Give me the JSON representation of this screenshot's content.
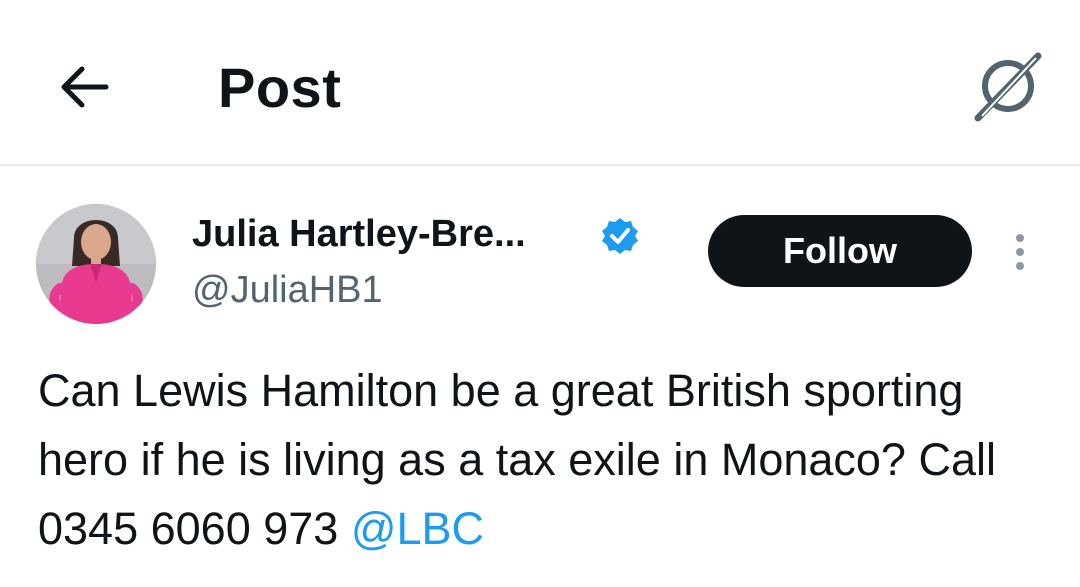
{
  "header": {
    "title": "Post",
    "back_icon": "arrow-left-icon",
    "grok_icon": "grok-icon"
  },
  "post": {
    "author": {
      "name": "Julia Hartley-Bre...",
      "handle": "@JuliaHB1",
      "verified": true,
      "verified_color": "#1d9bf0"
    },
    "follow_label": "Follow",
    "more_icon": "more-vertical-icon",
    "text": "Can Lewis Hamilton be a great British sporting hero if he is living as a tax exile in Monaco? Call 0345 6060 973 ",
    "mention": "@LBC",
    "mention_color": "#1d9bf0"
  }
}
